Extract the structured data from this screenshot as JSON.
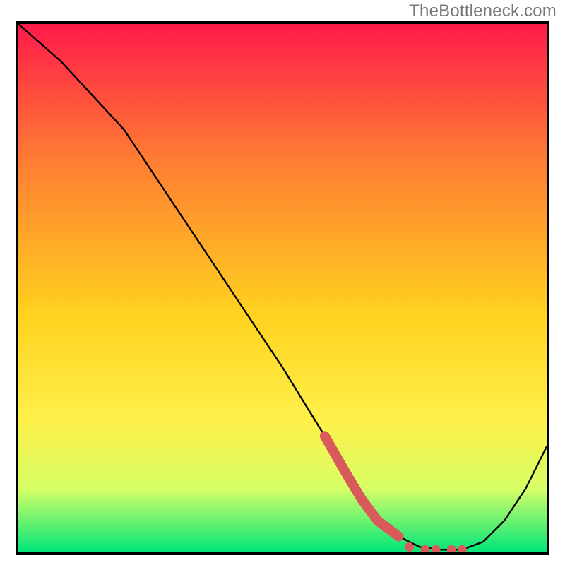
{
  "watermark": "TheBottleneck.com",
  "colors": {
    "gradient_top": "#ff1a4b",
    "gradient_mid_upper": "#ff7a33",
    "gradient_mid": "#ffd21f",
    "gradient_mid_lower": "#fff04a",
    "gradient_lower": "#d6ff66",
    "gradient_bottom": "#00e57a",
    "curve": "#000000",
    "dots": "#d85a5a"
  },
  "chart_data": {
    "type": "line",
    "title": "",
    "xlabel": "",
    "ylabel": "",
    "xlim": [
      0,
      100
    ],
    "ylim": [
      0,
      100
    ],
    "series": [
      {
        "name": "bottleneck-curve",
        "x": [
          0,
          8,
          20,
          30,
          40,
          50,
          58,
          62,
          65,
          68,
          72,
          76,
          80,
          84,
          88,
          92,
          96,
          100
        ],
        "y": [
          100,
          93,
          80,
          65,
          50,
          35,
          22,
          15,
          10,
          6,
          3,
          1,
          0.5,
          0.5,
          2,
          6,
          12,
          20
        ]
      },
      {
        "name": "highlight-segment",
        "x": [
          58,
          62,
          65,
          68,
          72
        ],
        "y": [
          22,
          15,
          10,
          6,
          3
        ]
      },
      {
        "name": "bottom-dots",
        "x": [
          74,
          77,
          79,
          82,
          84
        ],
        "y": [
          1,
          0.5,
          0.5,
          0.5,
          0.5
        ]
      }
    ],
    "gradient_stops_pct": [
      {
        "offset": 0,
        "color": "#ff1a4b"
      },
      {
        "offset": 25,
        "color": "#ff7a33"
      },
      {
        "offset": 55,
        "color": "#ffd21f"
      },
      {
        "offset": 75,
        "color": "#fff04a"
      },
      {
        "offset": 88,
        "color": "#d6ff66"
      },
      {
        "offset": 100,
        "color": "#00e57a"
      }
    ]
  }
}
